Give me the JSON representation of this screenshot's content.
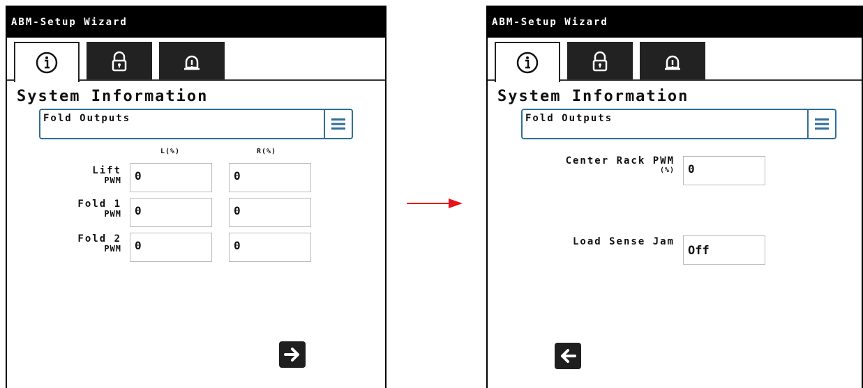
{
  "left": {
    "title": "ABM-Setup Wizard",
    "heading": "System Information",
    "dropdown": {
      "selected": "Fold Outputs"
    },
    "table": {
      "columns": [
        "L(%)",
        "R(%)"
      ],
      "rows": [
        {
          "label": "Lift",
          "sublabel": "PWM",
          "values": [
            "0",
            "0"
          ]
        },
        {
          "label": "Fold 1",
          "sublabel": "PWM",
          "values": [
            "0",
            "0"
          ]
        },
        {
          "label": "Fold 2",
          "sublabel": "PWM",
          "values": [
            "0",
            "0"
          ]
        }
      ]
    }
  },
  "right": {
    "title": "ABM-Setup Wizard",
    "heading": "System Information",
    "dropdown": {
      "selected": "Fold Outputs"
    },
    "center_rack": {
      "label": "Center Rack PWM",
      "unit": "(%)",
      "value": "0"
    },
    "load_sense": {
      "label": "Load Sense Jam",
      "value": "Off"
    }
  },
  "icons": {
    "tab1": "info-icon",
    "tab2": "lock-icon",
    "tab3": "bell-alert-icon",
    "next": "arrow-right-icon",
    "back": "arrow-left-icon",
    "dropdown": "menu-icon"
  },
  "colors": {
    "accent": "#2f6f94",
    "transition_arrow": "#e8141c",
    "titlebar": "#000000"
  }
}
